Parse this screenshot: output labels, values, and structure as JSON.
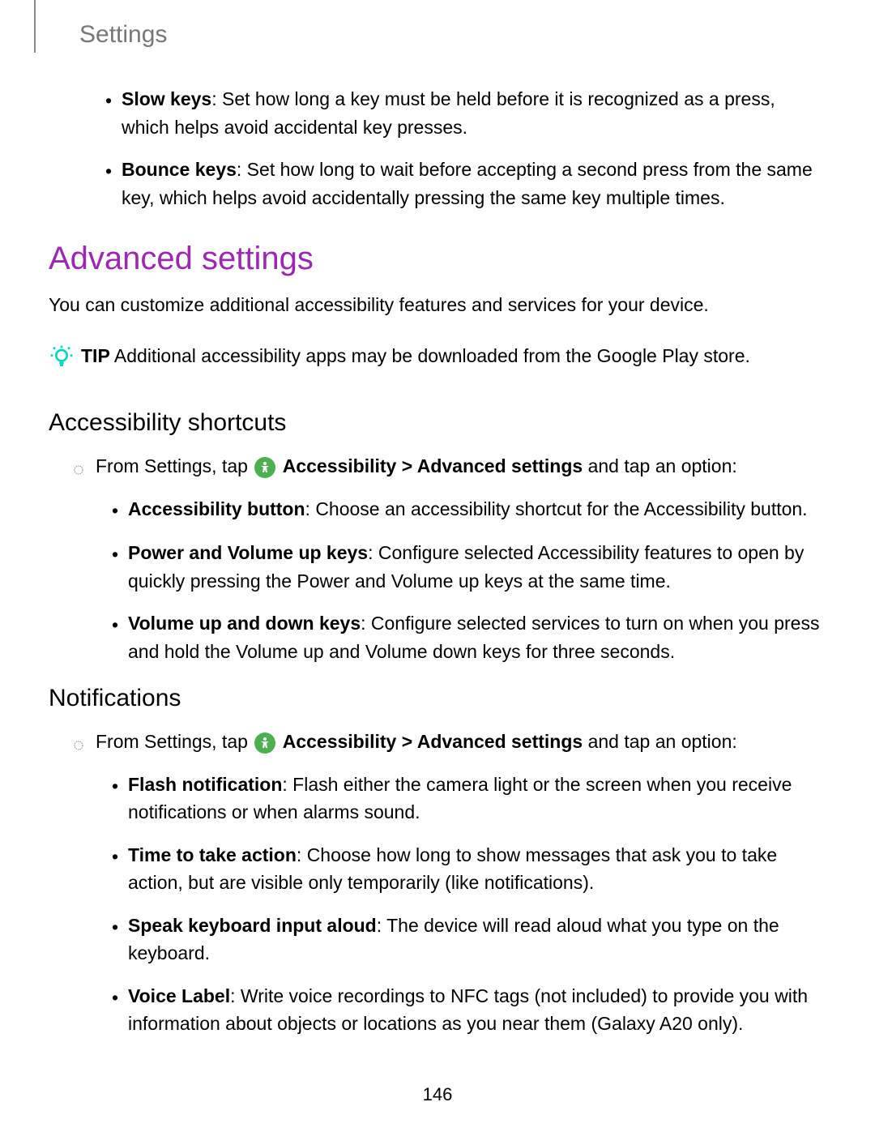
{
  "header": {
    "title": "Settings"
  },
  "top_bullets": [
    {
      "bold": "Slow keys",
      "text": ": Set how long a key must be held before it is recognized as a press, which helps avoid accidental key presses."
    },
    {
      "bold": "Bounce keys",
      "text": ": Set how long to wait before accepting a second press from the same key, which helps avoid accidentally pressing the same key multiple times."
    }
  ],
  "heading": "Advanced settings",
  "intro": "You can customize additional accessibility features and services for your device.",
  "tip": {
    "label": "TIP",
    "text": "  Additional accessibility apps may be downloaded from the Google Play store."
  },
  "sections": [
    {
      "title": "Accessibility shortcuts",
      "step": {
        "pre": "From Settings, tap ",
        "link_bold": "Accessibility",
        "sep": " > ",
        "link_bold2": "Advanced settings",
        "post": " and tap an option:"
      },
      "items": [
        {
          "bold": "Accessibility button",
          "text": ": Choose an accessibility shortcut for the Accessibility button."
        },
        {
          "bold": "Power and Volume up keys",
          "text": ": Configure selected Accessibility features to open by quickly pressing the Power and Volume up keys at the same time."
        },
        {
          "bold": "Volume up and down keys",
          "text": ": Configure selected services to turn on when you press and hold the Volume up and Volume down keys for three seconds."
        }
      ]
    },
    {
      "title": "Notifications",
      "step": {
        "pre": "From Settings, tap ",
        "link_bold": "Accessibility",
        "sep": " > ",
        "link_bold2": "Advanced settings",
        "post": " and tap an option:"
      },
      "items": [
        {
          "bold": "Flash notification",
          "text": ": Flash either the camera light or the screen when you receive notifications or when alarms sound."
        },
        {
          "bold": "Time to take action",
          "text": ": Choose how long to show messages that ask you to take action, but are visible only temporarily (like notifications)."
        },
        {
          "bold": "Speak keyboard input aloud",
          "text": ": The device will read aloud what you type on the keyboard."
        },
        {
          "bold": "Voice Label",
          "text": ": Write voice recordings to NFC tags (not included) to provide you with information about objects or locations as you near them (Galaxy A20 only)."
        }
      ]
    }
  ],
  "page_number": "146"
}
